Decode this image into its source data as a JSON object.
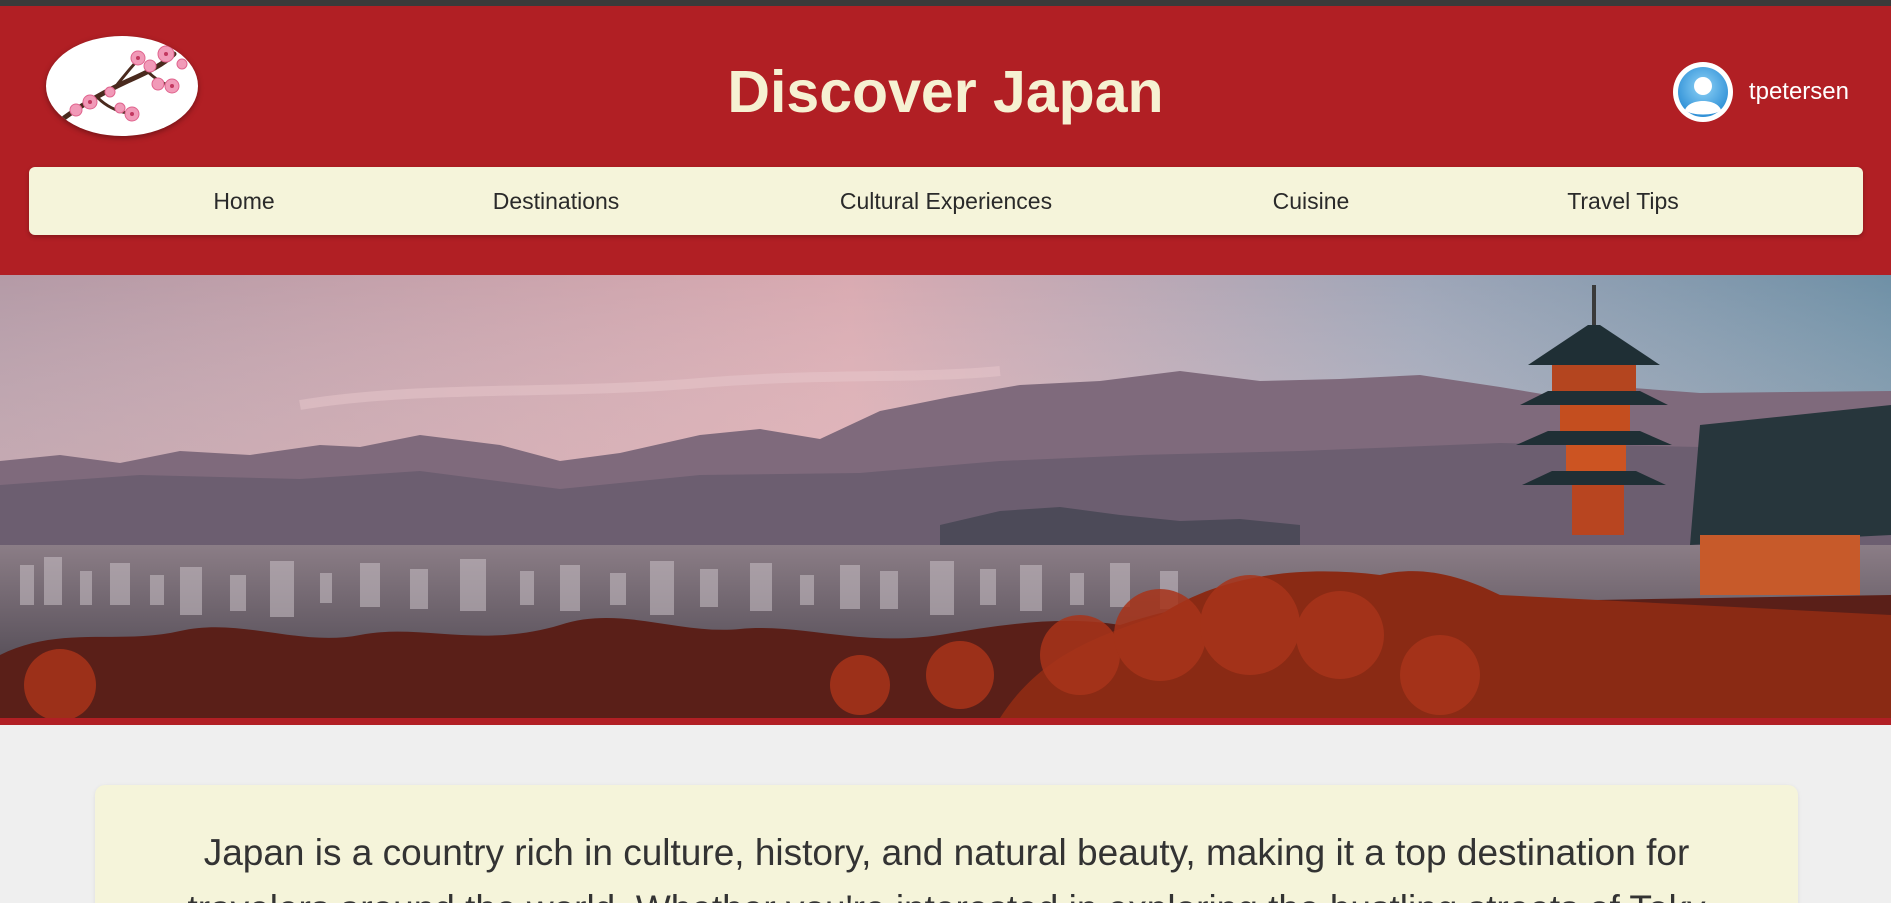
{
  "header": {
    "title": "Discover Japan",
    "logo_icon": "cherry-blossom-branch-icon",
    "user": {
      "username": "tpetersen",
      "avatar_icon": "user-avatar-icon"
    }
  },
  "nav": {
    "items": [
      {
        "label": "Home"
      },
      {
        "label": "Destinations"
      },
      {
        "label": "Cultural Experiences"
      },
      {
        "label": "Cuisine"
      },
      {
        "label": "Travel Tips"
      }
    ]
  },
  "hero": {
    "image_icon": "kyoto-pagoda-skyline-photo"
  },
  "intro": {
    "text": "Japan is a country rich in culture, history, and natural beauty, making it a top destination for travelers around the world. Whether you're interested in exploring the bustling streets of Toky"
  },
  "colors": {
    "header_bg": "#b11f24",
    "title_text": "#f6f1d2",
    "nav_bg": "#f5f4da",
    "page_bg": "#efefef",
    "intro_bg": "#f5f4da"
  }
}
